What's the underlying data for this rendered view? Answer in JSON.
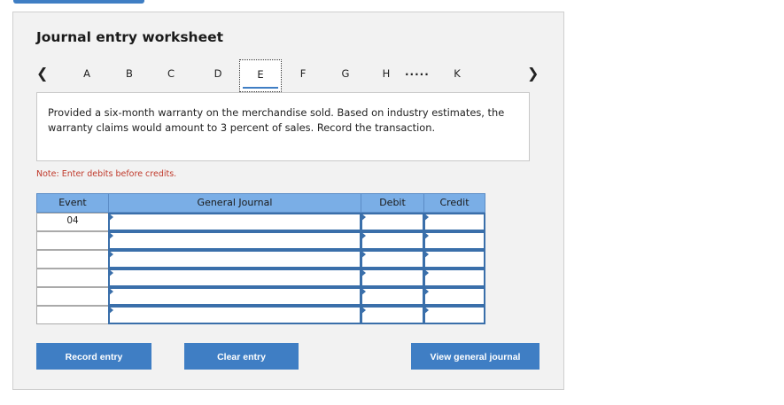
{
  "title": "Journal entry worksheet",
  "nav": {
    "prev_icon": "chevron-left-icon",
    "next_icon": "chevron-right-icon",
    "letters": [
      "A",
      "B",
      "C",
      "D",
      "E",
      "F",
      "G",
      "H",
      "K"
    ],
    "active": "E",
    "ellipsis": "....."
  },
  "description": "Provided a six-month warranty on the merchandise sold. Based on industry estimates, the warranty claims would amount to 3 percent of sales. Record the transaction.",
  "note": "Note: Enter debits before credits.",
  "table": {
    "headers": {
      "event": "Event",
      "journal": "General Journal",
      "debit": "Debit",
      "credit": "Credit"
    },
    "event_value": "04"
  },
  "buttons": {
    "record": "Record entry",
    "clear": "Clear entry",
    "view": "View general journal"
  },
  "colors": {
    "accent": "#3f7ec4",
    "header": "#7aaee6",
    "note": "#c0392b"
  }
}
